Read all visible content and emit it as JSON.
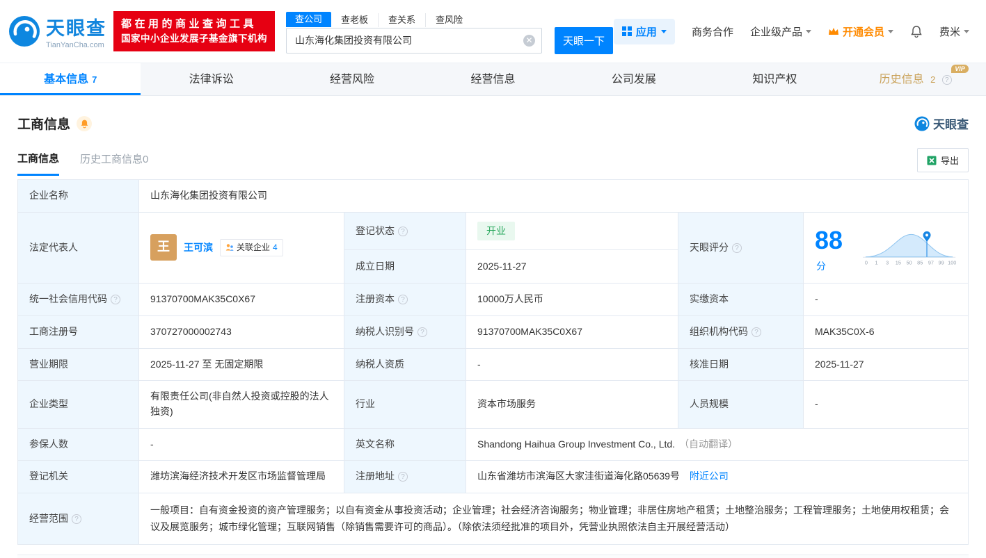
{
  "brand": {
    "name": "天眼查",
    "domain": "TianYanCha.com"
  },
  "header": {
    "promo_line1": "都在用的商业查询工具",
    "promo_line2": "国家中小企业发展子基金旗下机构",
    "search_tabs": [
      {
        "label": "查公司"
      },
      {
        "label": "查老板"
      },
      {
        "label": "查关系"
      },
      {
        "label": "查风险"
      }
    ],
    "search_value": "山东海化集团投资有限公司",
    "search_button": "天眼一下",
    "menu_apps": "应用",
    "menu_cooperation": "商务合作",
    "menu_enterprise": "企业级产品",
    "menu_vip": "开通会员",
    "menu_user": "费米"
  },
  "nav": {
    "tabs": [
      {
        "label": "基本信息",
        "count": "7"
      },
      {
        "label": "法律诉讼"
      },
      {
        "label": "经营风险"
      },
      {
        "label": "经营信息"
      },
      {
        "label": "公司发展"
      },
      {
        "label": "知识产权"
      },
      {
        "label": "历史信息",
        "count": "2",
        "vip": "VIP"
      }
    ]
  },
  "section": {
    "title": "工商信息",
    "watermark": "天眼查",
    "subtab_active": "工商信息",
    "subtab_history": "历史工商信息0",
    "export_label": "导出"
  },
  "fields": {
    "company_name_label": "企业名称",
    "company_name": "山东海化集团投资有限公司",
    "legal_rep_label": "法定代表人",
    "legal_rep_avatar": "王",
    "legal_rep_name": "王可滨",
    "related_companies_label": "关联企业",
    "related_companies_count": "4",
    "reg_status_label": "登记状态",
    "reg_status": "开业",
    "establish_date_label": "成立日期",
    "establish_date": "2025-11-27",
    "score_label": "天眼评分",
    "score_value": "88",
    "score_unit": "分",
    "score_axis": [
      "0",
      "1",
      "3",
      "15",
      "50",
      "85",
      "97",
      "99",
      "100"
    ],
    "credit_code_label": "统一社会信用代码",
    "credit_code": "91370700MAK35C0X67",
    "reg_capital_label": "注册资本",
    "reg_capital": "10000万人民币",
    "paid_capital_label": "实缴资本",
    "paid_capital": "-",
    "reg_number_label": "工商注册号",
    "reg_number": "370727000002743",
    "taxpayer_id_label": "纳税人识别号",
    "taxpayer_id": "91370700MAK35C0X67",
    "org_code_label": "组织机构代码",
    "org_code": "MAK35C0X-6",
    "business_term_label": "营业期限",
    "business_term": "2025-11-27 至 无固定期限",
    "taxpayer_quality_label": "纳税人资质",
    "taxpayer_quality": "-",
    "approval_date_label": "核准日期",
    "approval_date": "2025-11-27",
    "company_type_label": "企业类型",
    "company_type": "有限责任公司(非自然人投资或控股的法人独资)",
    "industry_label": "行业",
    "industry": "资本市场服务",
    "staff_size_label": "人员规模",
    "staff_size": "-",
    "insured_label": "参保人数",
    "insured": "-",
    "english_name_label": "英文名称",
    "english_name": "Shandong Haihua Group Investment Co., Ltd.",
    "english_name_note": "（自动翻译）",
    "reg_authority_label": "登记机关",
    "reg_authority": "潍坊滨海经济技术开发区市场监督管理局",
    "address_label": "注册地址",
    "address": "山东省潍坊市滨海区大家洼街道海化路05639号",
    "nearby_link": "附近公司",
    "scope_label": "经营范围",
    "scope": "一般项目：自有资金投资的资产管理服务；以自有资金从事投资活动；企业管理；社会经济咨询服务；物业管理；非居住房地产租赁；土地整治服务；工程管理服务；土地使用权租赁；会议及展览服务；城市绿化管理；互联网销售（除销售需要许可的商品）。（除依法须经批准的项目外，凭营业执照依法自主开展经营活动）"
  }
}
